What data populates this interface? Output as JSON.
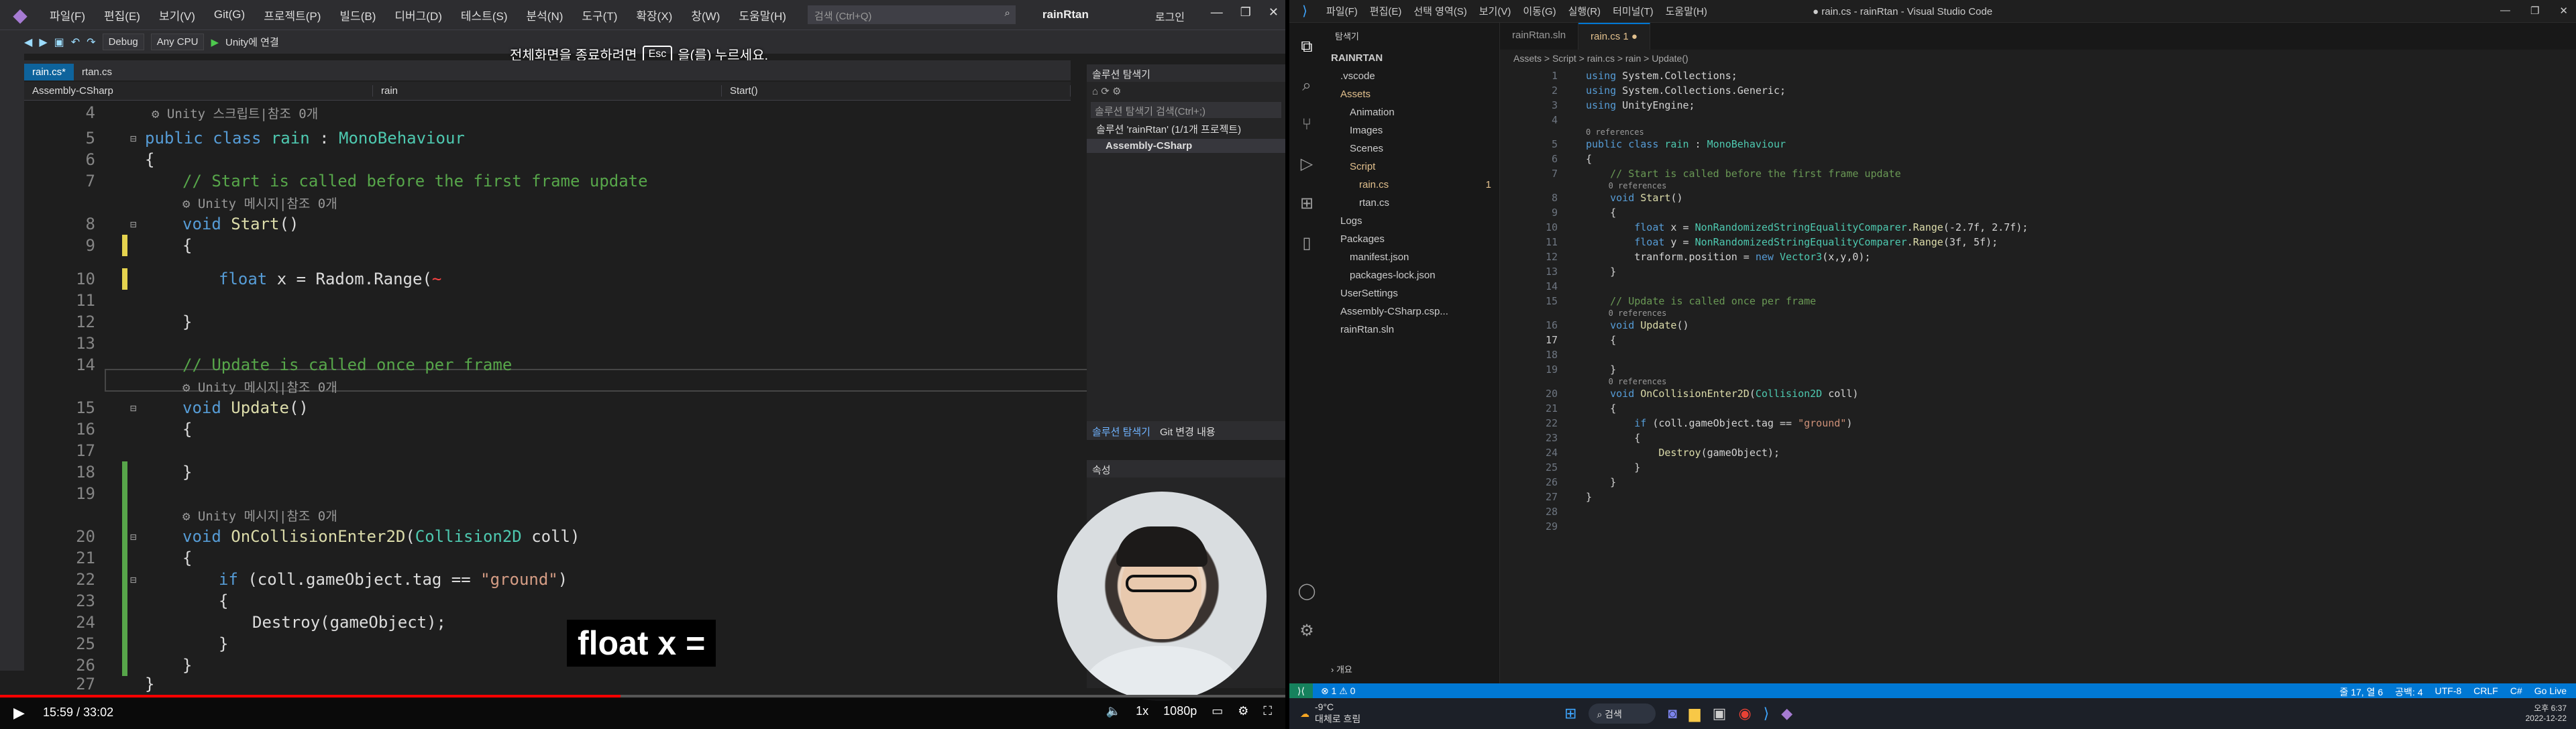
{
  "vs": {
    "menu": [
      "파일(F)",
      "편집(E)",
      "보기(V)",
      "Git(G)",
      "프로젝트(P)",
      "빌드(B)",
      "디버그(D)",
      "테스트(S)",
      "분석(N)",
      "도구(T)",
      "확장(X)",
      "창(W)",
      "도움말(H)"
    ],
    "search_placeholder": "검색 (Ctrl+Q)",
    "project_name": "rainRtan",
    "login": "로그인",
    "toolbar": {
      "config": "Debug",
      "platform": "Any CPU",
      "run_label": "Unity에 연결"
    },
    "esc_banner_before": "전체화면을 종료하려면",
    "esc_key": "Esc",
    "esc_banner_after": "을(를) 누르세요.",
    "tabs": [
      "rain.cs*",
      "rtan.cs"
    ],
    "nav": {
      "project": "Assembly-CSharp",
      "class": "rain",
      "member": "Start()"
    },
    "lens_unity_script": "Unity 스크립트|참조 0개",
    "lens_unity_msg": "Unity 메시지|참조 0개",
    "code": {
      "l5a": "public class ",
      "l5b": "rain",
      "l5c": " : ",
      "l5d": "MonoBehaviour",
      "l7": "// Start is called before the first frame update",
      "l8a": "void ",
      "l8b": "Start",
      "l8c": "()",
      "l10a": "float ",
      "l10b": "x = Radom.Range(",
      "l14": "// Update is called once per frame",
      "l15a": "void ",
      "l15b": "Update",
      "l15c": "()",
      "l20a": "void ",
      "l20b": "OnCollisionEnter2D",
      "l20c": "(",
      "l20d": "Collision2D",
      " l20e": " coll)",
      "l22a": "if ",
      "l22b": "(coll.gameObject.tag == ",
      "l22c": "\"ground\"",
      "l22d": ")",
      "l24": "Destroy(gameObject);",
      "open": "{",
      "close": "}"
    },
    "line_numbers": [
      "4",
      "5",
      "6",
      "7",
      "8",
      "9",
      "10",
      "11",
      "12",
      "13",
      "14",
      "15",
      "16",
      "17",
      "18",
      "19",
      "20",
      "21",
      "22",
      "23",
      "24",
      "25",
      "26",
      "27"
    ],
    "solution_explorer": {
      "title": "솔루션 탐색기",
      "search": "솔루션 탐색기 검색(Ctrl+;)",
      "solution": "솔루션 'rainRtan' (1/1개 프로젝트)",
      "project": "Assembly-CSharp",
      "tab1": "솔루션 탐색기",
      "tab2": "Git 변경 내용"
    },
    "props_title": "속성",
    "video": {
      "time": "15:59 / 33:02",
      "speed": "1x",
      "quality": "1080p",
      "progress": 0.483
    },
    "caption": "float x ="
  },
  "vsc": {
    "menu": [
      "파일(F)",
      "편집(E)",
      "선택 영역(S)",
      "보기(V)",
      "이동(G)",
      "실행(R)",
      "터미널(T)",
      "도움말(H)"
    ],
    "window_title": "● rain.cs - rainRtan - Visual Studio Code",
    "explorer_title": "탐색기",
    "tree": [
      {
        "label": "RAINRTAN",
        "indent": 0,
        "bold": true
      },
      {
        "label": ".vscode",
        "indent": 1
      },
      {
        "label": "Assets",
        "indent": 1,
        "color": "#e2c08d"
      },
      {
        "label": "Animation",
        "indent": 2
      },
      {
        "label": "Images",
        "indent": 2
      },
      {
        "label": "Scenes",
        "indent": 2
      },
      {
        "label": "Script",
        "indent": 2,
        "color": "#e2c08d"
      },
      {
        "label": "rain.cs",
        "indent": 3,
        "color": "#e2c08d",
        "badge": "1"
      },
      {
        "label": "rtan.cs",
        "indent": 3
      },
      {
        "label": "Logs",
        "indent": 1
      },
      {
        "label": "Packages",
        "indent": 1
      },
      {
        "label": "manifest.json",
        "indent": 2
      },
      {
        "label": "packages-lock.json",
        "indent": 2
      },
      {
        "label": "UserSettings",
        "indent": 1
      },
      {
        "label": "Assembly-CSharp.csp...",
        "indent": 1
      },
      {
        "label": "rainRtan.sln",
        "indent": 1
      }
    ],
    "outline": "개요",
    "tabs": [
      "rainRtan.sln",
      "rain.cs  1 ●"
    ],
    "breadcrumb": "Assets > Script > rain.cs > rain > Update()",
    "refs": "0 references",
    "lines": [
      {
        "n": "1",
        "t": "using System.Collections;"
      },
      {
        "n": "2",
        "t": "using System.Collections.Generic;"
      },
      {
        "n": "3",
        "t": "using UnityEngine;"
      },
      {
        "n": "4",
        "t": ""
      },
      {
        "n": "5",
        "t": "public class rain : MonoBehaviour",
        "refs": true
      },
      {
        "n": "6",
        "t": "{"
      },
      {
        "n": "7",
        "t": "    // Start is called before the first frame update"
      },
      {
        "n": "8",
        "t": "    void Start()",
        "refs": true
      },
      {
        "n": "9",
        "t": "    {"
      },
      {
        "n": "10",
        "t": "        float x = NonRandomizedStringEqualityComparer.Range(-2.7f, 2.7f);"
      },
      {
        "n": "11",
        "t": "        float y = NonRandomizedStringEqualityComparer.Range(3f, 5f);"
      },
      {
        "n": "12",
        "t": "        tranform.position = new Vector3(x,y,0);"
      },
      {
        "n": "13",
        "t": "    }"
      },
      {
        "n": "14",
        "t": ""
      },
      {
        "n": "15",
        "t": "    // Update is called once per frame"
      },
      {
        "n": "16",
        "t": "    void Update()",
        "refs": true
      },
      {
        "n": "17",
        "t": "    {"
      },
      {
        "n": "18",
        "t": ""
      },
      {
        "n": "19",
        "t": "    }"
      },
      {
        "n": "20",
        "t": "    void OnCollisionEnter2D(Collision2D coll)",
        "refs": true
      },
      {
        "n": "21",
        "t": "    {"
      },
      {
        "n": "22",
        "t": "        if (coll.gameObject.tag == \"ground\")"
      },
      {
        "n": "23",
        "t": "        {"
      },
      {
        "n": "24",
        "t": "            Destroy(gameObject);"
      },
      {
        "n": "25",
        "t": "        }"
      },
      {
        "n": "26",
        "t": "    }"
      },
      {
        "n": "27",
        "t": "}"
      },
      {
        "n": "28",
        "t": ""
      },
      {
        "n": "29",
        "t": ""
      }
    ],
    "status_left": "⊗ 1 ⚠ 0",
    "status_right": [
      "줄 17, 열 6",
      "공백: 4",
      "UTF-8",
      "CRLF",
      "C#",
      "Go Live"
    ],
    "taskbar": {
      "weather_temp": "-9°C",
      "weather_desc": "대체로 흐림",
      "search": "검색",
      "time": "오후 6:37",
      "date": "2022-12-22"
    }
  }
}
